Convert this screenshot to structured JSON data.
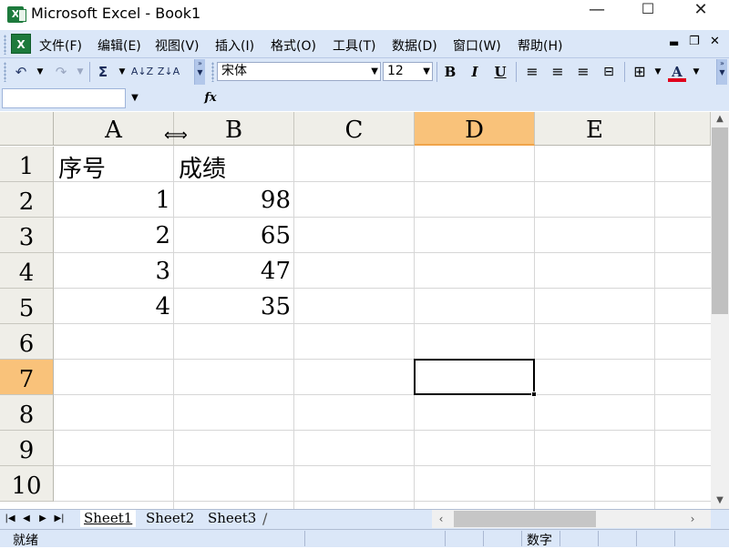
{
  "window": {
    "title": "Microsoft Excel - Book1",
    "controls": {
      "minimize": "—",
      "maximize": "☐",
      "close": "✕"
    }
  },
  "menu": [
    {
      "label": "文件(F)"
    },
    {
      "label": "编辑(E)"
    },
    {
      "label": "视图(V)"
    },
    {
      "label": "插入(I)"
    },
    {
      "label": "格式(O)"
    },
    {
      "label": "工具(T)"
    },
    {
      "label": "数据(D)"
    },
    {
      "label": "窗口(W)"
    },
    {
      "label": "帮助(H)"
    }
  ],
  "menu_right": {
    "minimize": "▬",
    "restore": "❐",
    "close": "✕"
  },
  "toolbar": {
    "undo": "↶",
    "redo": "↷",
    "sum": "Σ",
    "sort_asc": "A↓Z",
    "sort_desc": "Z↓A",
    "font_name": "宋体",
    "font_size": "12",
    "bold": "B",
    "italic": "I",
    "underline": "U",
    "borders": "⊞",
    "font_color_letter": "A",
    "font_color": "#e0001b"
  },
  "formula": {
    "name_box": "",
    "fx": "fx",
    "content": ""
  },
  "grid": {
    "columns": [
      "A",
      "B",
      "C",
      "D",
      "E"
    ],
    "rows": [
      "1",
      "2",
      "3",
      "4",
      "5",
      "6",
      "7",
      "8",
      "9",
      "10"
    ],
    "active_column": "D",
    "active_row": "7",
    "cells": {
      "A1": "序号",
      "B1": "成绩",
      "A2": "1",
      "B2": "98",
      "A3": "2",
      "B3": "65",
      "A4": "3",
      "B4": "47",
      "A5": "4",
      "B5": "35"
    }
  },
  "sheets": [
    {
      "label": "Sheet1"
    },
    {
      "label": "Sheet2"
    },
    {
      "label": "Sheet3"
    }
  ],
  "status": {
    "text": "就绪",
    "numlock": "数字"
  },
  "colors": {
    "chrome": "#dbe7f8",
    "active_header": "#f9c27a",
    "header": "#efeee8"
  },
  "icons": {
    "app": "excel-icon",
    "resize_cursor": "column-resize-cursor"
  }
}
